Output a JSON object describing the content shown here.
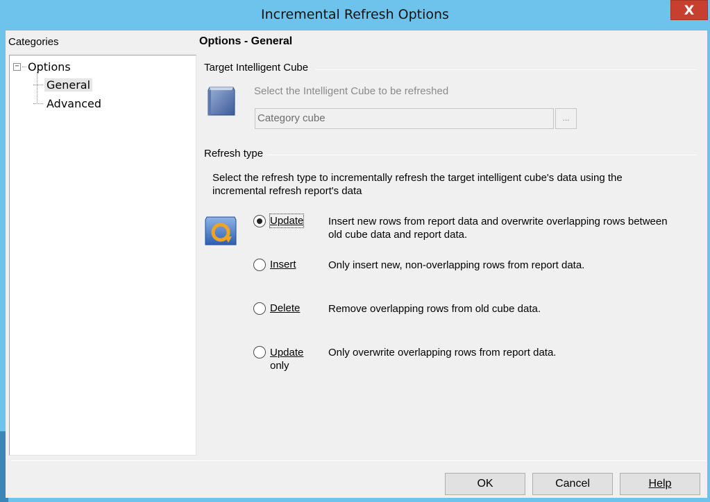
{
  "window": {
    "title": "Incremental Refresh Options",
    "close_label": "X"
  },
  "categories": {
    "label": "Categories",
    "tree": {
      "root": "Options",
      "children": [
        "General",
        "Advanced"
      ],
      "selected": "General"
    }
  },
  "main": {
    "section_title": "Options - General",
    "target": {
      "group_label": "Target Intelligent Cube",
      "hint": "Select the Intelligent Cube to be refreshed",
      "cube_value": "Category cube",
      "browse_label": "..."
    },
    "refresh": {
      "group_label": "Refresh type",
      "description_line1": "Select the refresh type to incrementally refresh the target intelligent cube's data using the",
      "description_line2": "incremental refresh report's data",
      "options": [
        {
          "label": "Update",
          "desc_line1": "Insert new rows from report data and overwrite overlapping rows between",
          "desc_line2": "old cube data and report data.",
          "checked": true
        },
        {
          "label": "Insert",
          "desc_line1": "Only insert new, non-overlapping rows from report data.",
          "checked": false
        },
        {
          "label": "Delete",
          "desc_line1": "Remove overlapping rows from old cube data.",
          "checked": false
        },
        {
          "label_line1": "Update",
          "label_line2": "only",
          "desc_line1": "Only overwrite overlapping rows from report data.",
          "checked": false
        }
      ]
    }
  },
  "buttons": {
    "ok": "OK",
    "cancel": "Cancel",
    "help": "Help"
  },
  "colors": {
    "titlebar": "#6dc3ec",
    "close": "#c7402f",
    "dialog_bg": "#f0f0f0"
  },
  "icons": {
    "target": "cube-icon",
    "refresh": "refresh-icon"
  }
}
